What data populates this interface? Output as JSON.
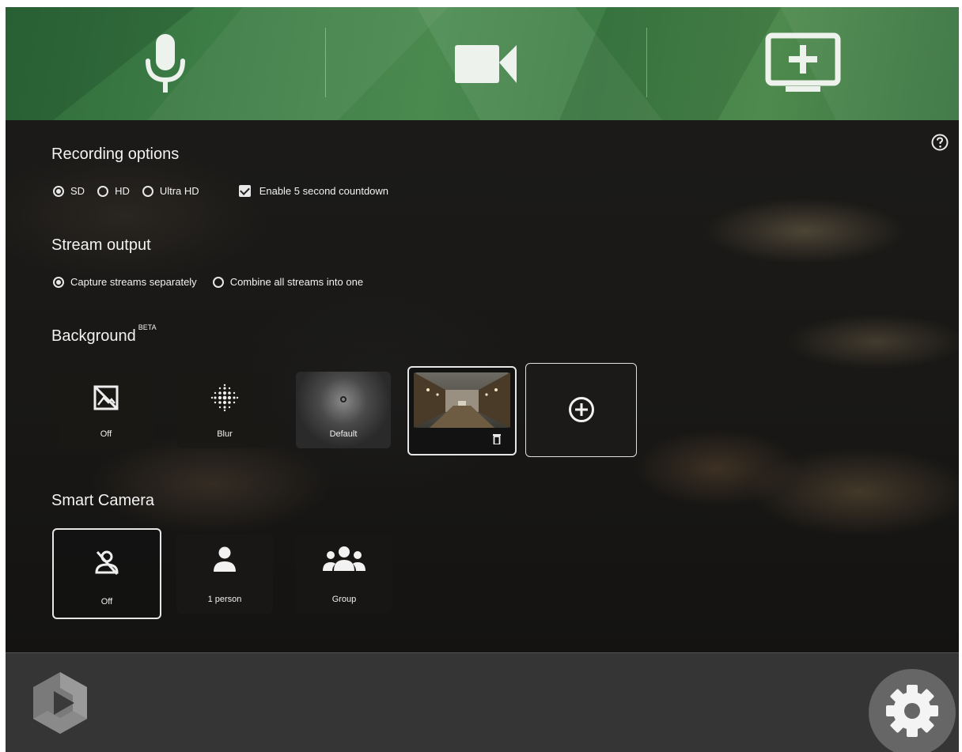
{
  "sources": {
    "audio_icon": "microphone-icon",
    "video_icon": "video-camera-icon",
    "screen_icon": "add-screen-icon"
  },
  "colors": {
    "header_green": "#3d7d46",
    "bottom_bar": "#353535",
    "text": "#f2f2f2"
  },
  "recording": {
    "title": "Recording options",
    "quality_options": [
      {
        "label": "SD",
        "selected": true
      },
      {
        "label": "HD",
        "selected": false
      },
      {
        "label": "Ultra HD",
        "selected": false
      }
    ],
    "countdown_label": "Enable 5 second countdown",
    "countdown_checked": true
  },
  "stream": {
    "title": "Stream output",
    "options": [
      {
        "label": "Capture streams separately",
        "selected": true
      },
      {
        "label": "Combine all streams into one",
        "selected": false
      }
    ]
  },
  "background": {
    "title": "Background",
    "badge": "BETA",
    "tiles": [
      {
        "label": "Off",
        "icon": "no-image-icon"
      },
      {
        "label": "Blur",
        "icon": "blur-icon"
      },
      {
        "label": "Default",
        "icon": "default-background-icon"
      },
      {
        "label": "",
        "icon": "library-thumbnail",
        "selected": true
      },
      {
        "label": "",
        "icon": "add-circle-icon"
      }
    ]
  },
  "smart_camera": {
    "title": "Smart Camera",
    "tiles": [
      {
        "label": "Off",
        "icon": "person-off-icon",
        "selected": true
      },
      {
        "label": "1 person",
        "icon": "person-icon"
      },
      {
        "label": "Group",
        "icon": "group-icon"
      }
    ]
  },
  "bottom": {
    "logo": "panopto-logo-icon",
    "settings_icon": "gear-icon"
  }
}
